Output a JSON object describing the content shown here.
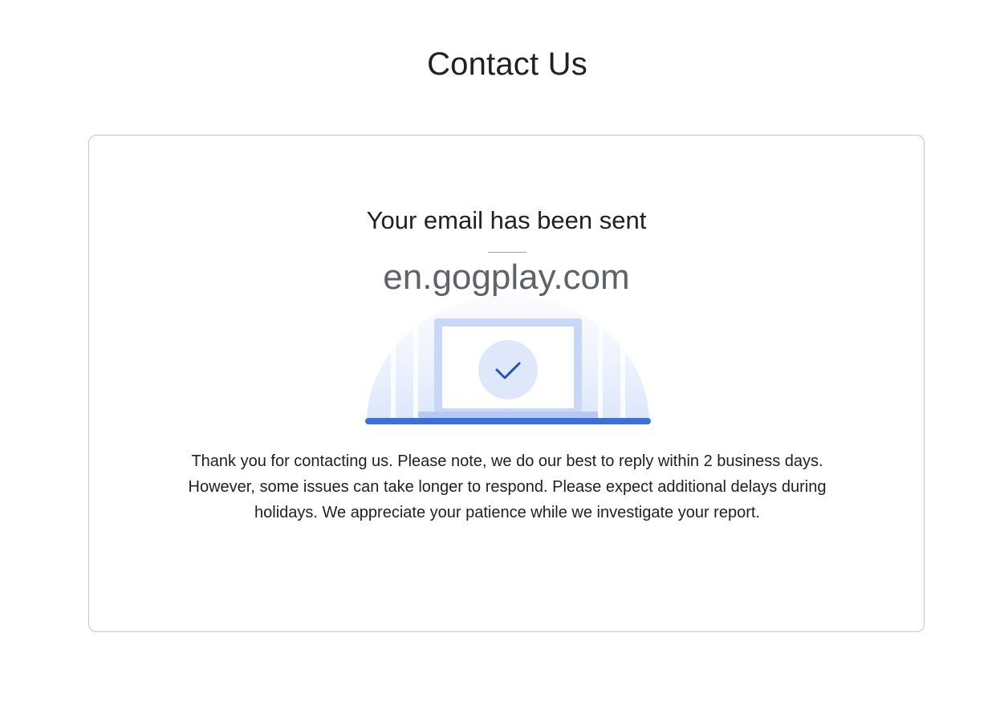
{
  "page": {
    "title": "Contact Us"
  },
  "confirmation": {
    "heading": "Your email has been sent",
    "site": "en.gogplay.com",
    "message": "Thank you for contacting us. Please note, we do our best to reply within 2 business days. However, some issues can take longer to respond. Please expect additional delays during holidays. We appreciate your patience while we investigate your report."
  },
  "illustration": {
    "icon": "checkmark-icon",
    "accent_color": "#3b6fe0",
    "circle_color": "#dfe8fb"
  }
}
